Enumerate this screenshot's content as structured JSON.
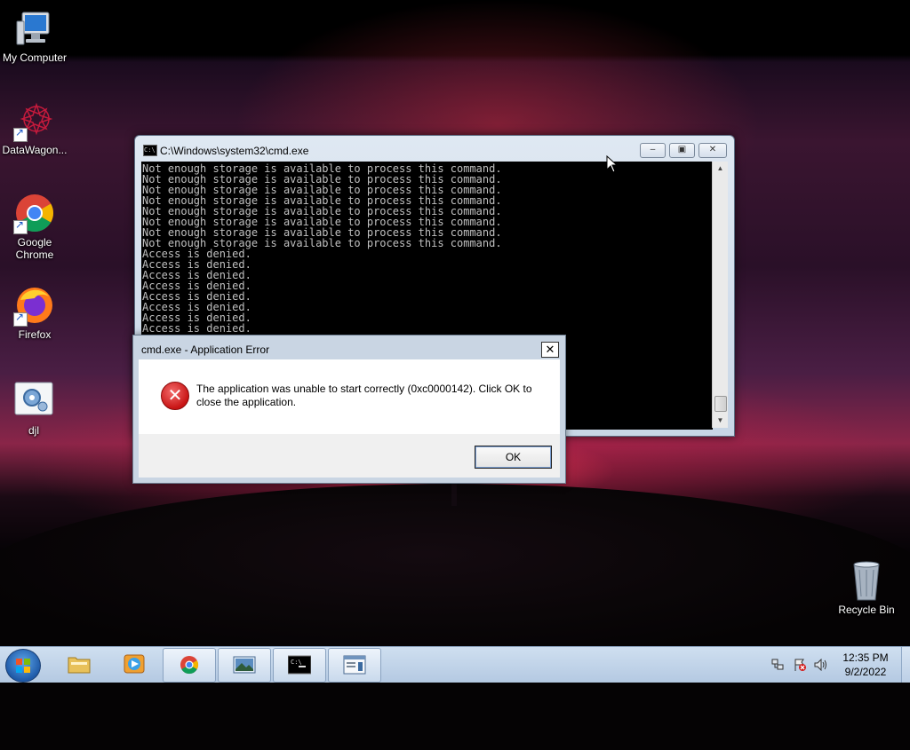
{
  "desktop": {
    "icons": [
      {
        "label": "My Computer",
        "icon": "computer-icon"
      },
      {
        "label": "DataWagon...",
        "icon": "datawagon-icon"
      },
      {
        "label": "Google Chrome",
        "icon": "chrome-icon"
      },
      {
        "label": "Firefox",
        "icon": "firefox-icon"
      },
      {
        "label": "djl",
        "icon": "settings-app-icon"
      },
      {
        "label": "Recycle Bin",
        "icon": "recycle-bin-icon"
      }
    ]
  },
  "cmd_window": {
    "title": "C:\\Windows\\system32\\cmd.exe",
    "lines": [
      "Not enough storage is available to process this command.",
      "Not enough storage is available to process this command.",
      "Not enough storage is available to process this command.",
      "Not enough storage is available to process this command.",
      "Not enough storage is available to process this command.",
      "Not enough storage is available to process this command.",
      "Not enough storage is available to process this command.",
      "Not enough storage is available to process this command.",
      "Access is denied.",
      "Access is denied.",
      "Access is denied.",
      "Access is denied.",
      "Access is denied.",
      "Access is denied.",
      "Access is denied.",
      "Access is denied."
    ]
  },
  "error_dialog": {
    "title": "cmd.exe - Application Error",
    "message": "The application was unable to start correctly (0xc0000142). Click OK to close the application.",
    "ok_label": "OK",
    "close_glyph": "✕"
  },
  "taskbar": {
    "items": [
      {
        "name": "file-explorer",
        "icon": "folder-icon",
        "active": false
      },
      {
        "name": "media-player",
        "icon": "media-player-icon",
        "active": false
      },
      {
        "name": "chrome",
        "icon": "chrome-icon",
        "active": true
      },
      {
        "name": "image-viewer",
        "icon": "image-viewer-icon",
        "active": true
      },
      {
        "name": "cmd",
        "icon": "cmd-icon",
        "active": true
      },
      {
        "name": "application",
        "icon": "app-window-icon",
        "active": true
      }
    ],
    "clock_time": "12:35 PM",
    "clock_date": "9/2/2022"
  },
  "colors": {
    "console_text": "#c0c0c0",
    "taskbar": "#b4c9e2",
    "error_icon": "#c81414"
  }
}
